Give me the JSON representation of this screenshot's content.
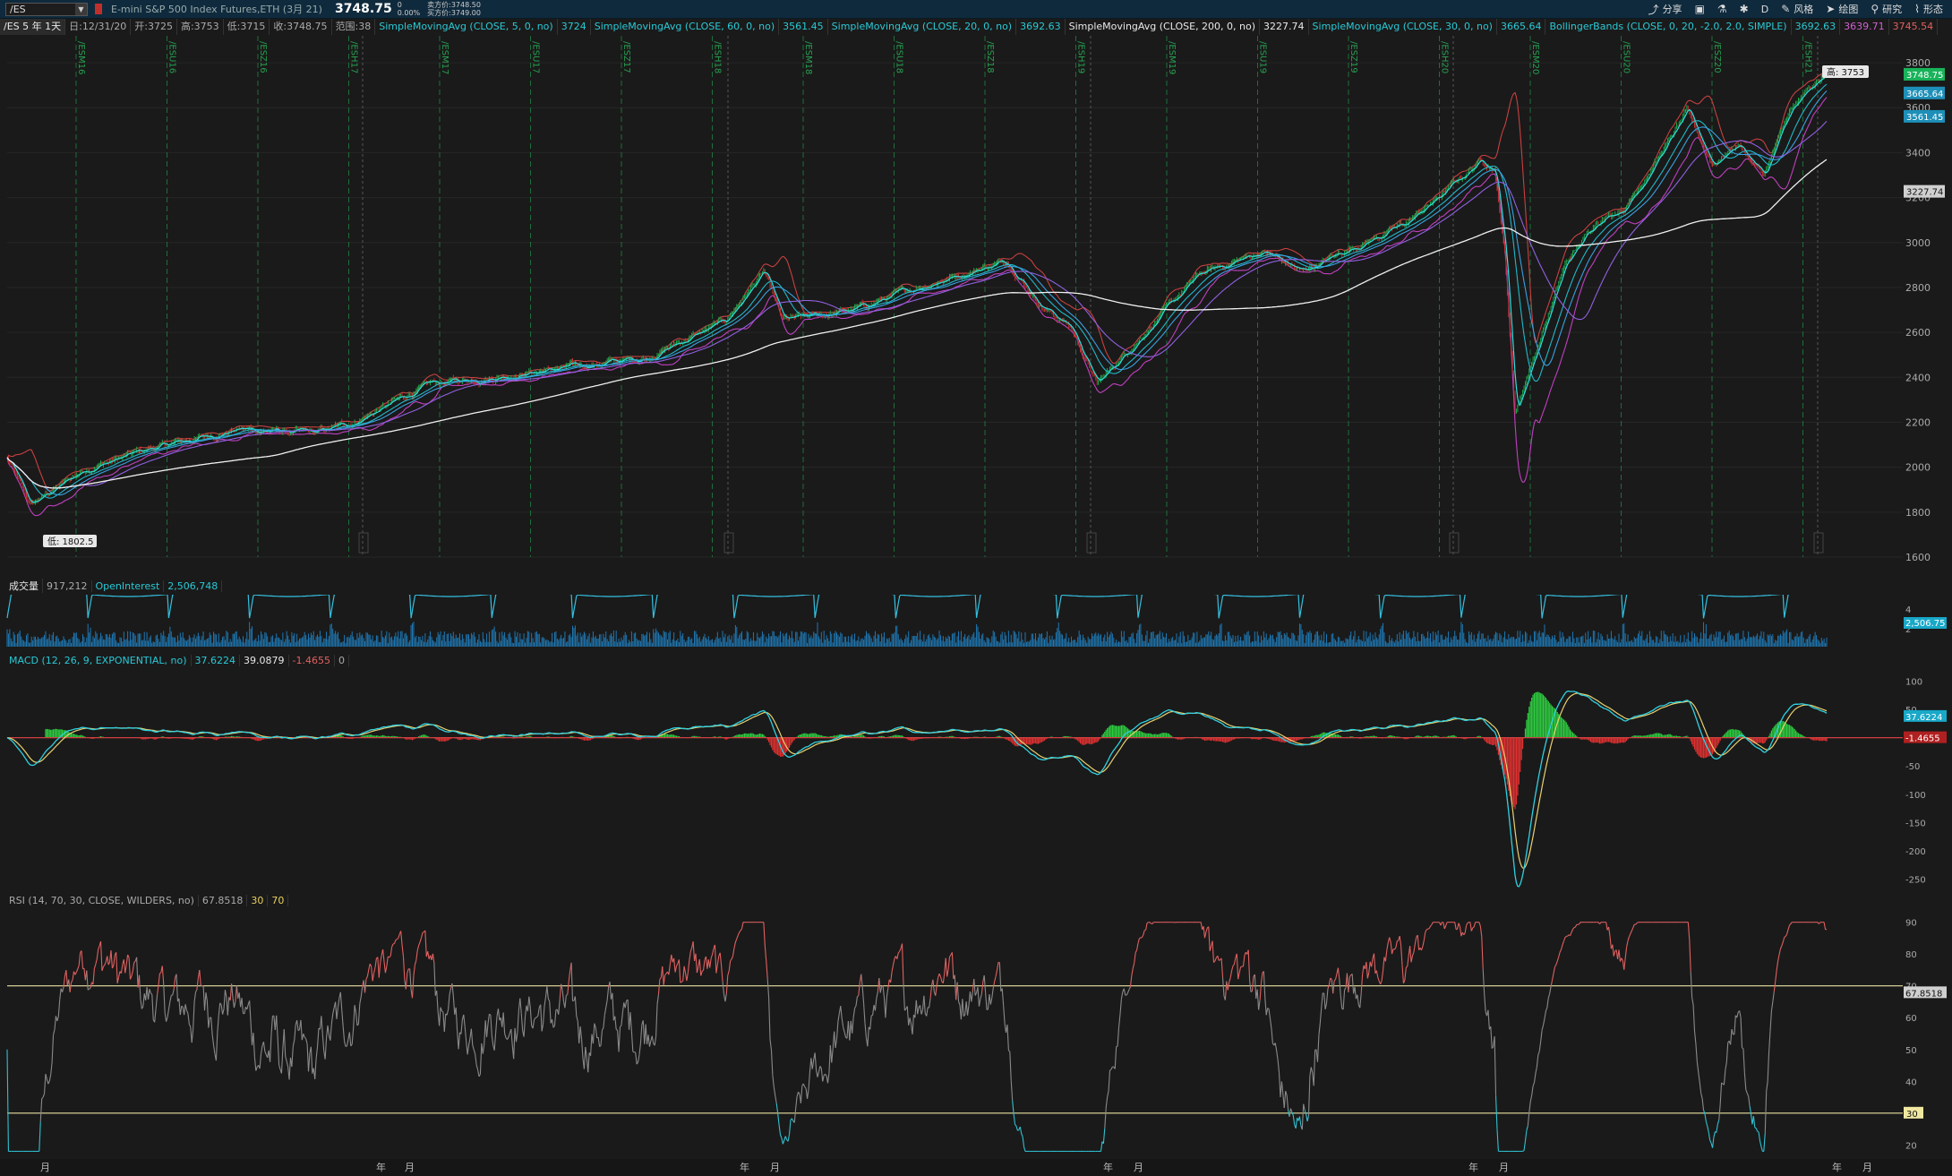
{
  "topbar": {
    "symbol": "/ES",
    "description": "E-mini S&P 500 Index Futures,ETH (3月 21)",
    "last_price": "3748.75",
    "change_value": "0",
    "change_pct": "0.00%",
    "bid": "卖方价:3748.50",
    "ask": "买方价:3749.00",
    "tools": [
      {
        "icon": "share-icon",
        "label": "分享"
      },
      {
        "icon": "calendar-icon",
        "label": ""
      },
      {
        "icon": "flask-icon",
        "label": ""
      },
      {
        "icon": "gear-icon",
        "label": ""
      },
      {
        "icon": "period-d",
        "label": "D"
      },
      {
        "icon": "style-icon",
        "label": "风格"
      },
      {
        "icon": "cursor-icon",
        "label": "绘图"
      },
      {
        "icon": "study-icon",
        "label": "研究"
      },
      {
        "icon": "pattern-icon",
        "label": "形态"
      }
    ]
  },
  "study_line": [
    {
      "text": "/ES 5 年 1天",
      "color": "white"
    },
    {
      "text": "日:12/31/20",
      "color": "gray"
    },
    {
      "text": "开:3725",
      "color": "gray"
    },
    {
      "text": "高:3753",
      "color": "gray"
    },
    {
      "text": "低:3715",
      "color": "gray"
    },
    {
      "text": "收:3748.75",
      "color": "gray"
    },
    {
      "text": "范围:38",
      "color": "gray"
    },
    {
      "text": "SimpleMovingAvg (CLOSE, 5, 0, no)",
      "color": "cyan"
    },
    {
      "text": "3724",
      "color": "cyan"
    },
    {
      "text": "SimpleMovingAvg (CLOSE, 60, 0, no)",
      "color": "cyan"
    },
    {
      "text": "3561.45",
      "color": "cyan"
    },
    {
      "text": "SimpleMovingAvg (CLOSE, 20, 0, no)",
      "color": "cyan"
    },
    {
      "text": "3692.63",
      "color": "cyan"
    },
    {
      "text": "SimpleMovingAvg (CLOSE, 200, 0, no)",
      "color": "white"
    },
    {
      "text": "3227.74",
      "color": "white"
    },
    {
      "text": "SimpleMovingAvg (CLOSE, 30, 0, no)",
      "color": "cyan"
    },
    {
      "text": "3665.64",
      "color": "cyan"
    },
    {
      "text": "BollingerBands (CLOSE, 0, 20, -2.0, 2.0, SIMPLE)",
      "color": "cyan"
    },
    {
      "text": "3692.63",
      "color": "cyan"
    },
    {
      "text": "3639.71",
      "color": "mag"
    },
    {
      "text": "3745.54",
      "color": "red"
    }
  ],
  "price_panel": {
    "high_label": "高: 3753",
    "low_label": "低: 1802.5",
    "y_ticks": [
      3800,
      3600,
      3400,
      3200,
      3000,
      2800,
      2600,
      2400,
      2200,
      2000,
      1800,
      1600
    ],
    "ylim": [
      1600,
      3880
    ],
    "markers": [
      {
        "value": 3748.75,
        "label": "3748.75",
        "color": "#18b35a"
      },
      {
        "value": 3665.64,
        "label": "3665.64",
        "color": "#1d8fb8"
      },
      {
        "value": 3561.45,
        "label": "3561.45",
        "color": "#1d8fb8"
      },
      {
        "value": 3227.74,
        "label": "3227.74",
        "color": "#d0d0d0"
      }
    ],
    "contracts": [
      "/ESM16",
      "/ESU16",
      "/ESZ16",
      "/ESH17",
      "/ESM17",
      "/ESU17",
      "/ESZ17",
      "/ESH18",
      "/ESM18",
      "/ESU18",
      "/ESZ18",
      "/ESH19",
      "/ESM19",
      "/ESU19",
      "/ESZ19",
      "/ESH20",
      "/ESM20",
      "/ESU20",
      "/ESZ20",
      "/ESH21"
    ],
    "year_markers": [
      "年",
      "年",
      "年",
      "年",
      "年"
    ]
  },
  "volume_panel": {
    "title": "成交量",
    "volume": "917,212",
    "oi_label": "OpenInterest",
    "oi_value": "2,506,748",
    "marker": "2,506.75",
    "ticks": [
      "4",
      "2"
    ]
  },
  "macd_panel": {
    "title": "MACD (12, 26, 9, EXPONENTIAL, no)",
    "value": "37.6224",
    "avg": "39.0879",
    "diff": "-1.4655",
    "zero": "0",
    "y_ticks": [
      100,
      50,
      0,
      -50,
      -100,
      -150,
      -200,
      -250
    ],
    "ylim": [
      -265,
      115
    ],
    "marker_value": "37.6224",
    "marker_diff": "-1.4655"
  },
  "rsi_panel": {
    "title": "RSI (14, 70, 30, CLOSE, WILDERS, no)",
    "value": "67.8518",
    "ob": "30",
    "os": "70",
    "y_ticks": [
      90,
      80,
      70,
      60,
      50,
      40,
      30,
      20
    ],
    "ylim": [
      17,
      93
    ],
    "marker_value": "67.8518",
    "marker_30": "30"
  },
  "time_axis": {
    "labels": [
      "月",
      "年",
      "月",
      "年",
      "月",
      "年",
      "月",
      "年",
      "月",
      "年",
      "月"
    ]
  },
  "chart_data": {
    "type": "line",
    "series": [
      {
        "name": "/ES",
        "x": [
          "2016-01",
          "2016-06",
          "2017-01",
          "2017-06",
          "2018-01",
          "2018-06",
          "2018-10",
          "2018-12",
          "2019-06",
          "2019-12",
          "2020-02",
          "2020-03",
          "2020-06",
          "2020-09",
          "2020-12"
        ],
        "values": [
          1900,
          2080,
          2270,
          2430,
          2840,
          2730,
          2920,
          2350,
          2940,
          3230,
          3380,
          2240,
          3100,
          3350,
          3748.75
        ]
      }
    ],
    "ylim": [
      1600,
      3880
    ]
  }
}
